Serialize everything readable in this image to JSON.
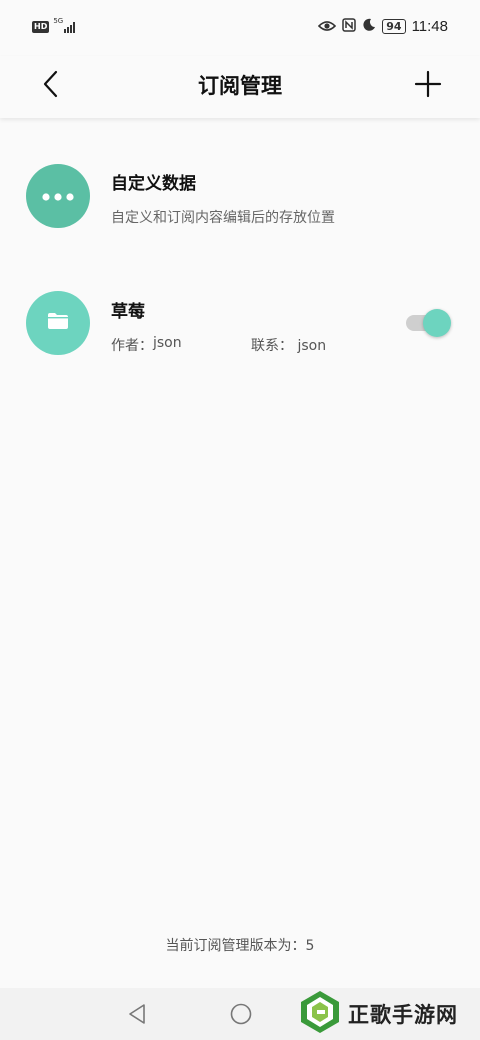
{
  "status_bar": {
    "hd": "HD",
    "network": "5G",
    "battery": "94",
    "time": "11:48",
    "icons": [
      "eye-icon",
      "nfc-icon",
      "moon-icon"
    ]
  },
  "app_bar": {
    "title": "订阅管理",
    "back_icon": "back-arrow-icon",
    "add_icon": "plus-icon"
  },
  "items": [
    {
      "title": "自定义数据",
      "subtitle": "自定义和订阅内容编辑后的存放位置",
      "icon": "more-dots-icon",
      "avatar_color": "#5bbfa4"
    },
    {
      "title": "草莓",
      "author_label": "作者：",
      "author": "json",
      "contact_label": "联系：",
      "contact": "json",
      "icon": "folder-icon",
      "avatar_color": "#6dd4bf",
      "enabled": true
    }
  ],
  "footer": {
    "version_text": "当前订阅管理版本为：5"
  },
  "nav_bar": {
    "icons": [
      "nav-back-icon",
      "nav-home-icon"
    ]
  },
  "watermark": {
    "text": "正歌手游网"
  },
  "colors": {
    "accent": "#6dd4bf",
    "accent_dark": "#5bbfa4",
    "background": "#fafafa"
  }
}
